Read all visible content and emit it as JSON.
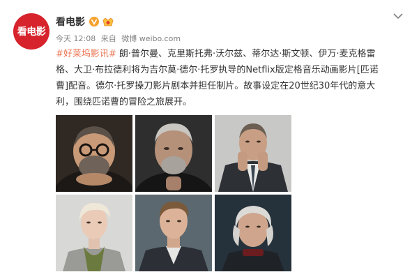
{
  "post": {
    "author": "看电影",
    "avatar_text": "看电影",
    "time": "今天 12:08",
    "source_prefix": "来自",
    "source": "微博 weibo.com",
    "hashtag": "#好莱坞影讯#",
    "body_lines": [
      " 朗·普尔曼、克里斯托弗·沃尔兹、蒂尔达·斯文顿、伊万·麦克格雷",
      "格、大卫·布拉德利将为吉尔莫·德尔·托罗执导的Netflix版定格音乐动画影片[匹诺",
      "曹]配音。德尔·托罗操刀影片剧本并担任制片。故事设定在20世纪30年代的意大",
      "利，围绕匹诺曹的冒险之旅展开。"
    ]
  },
  "icons": {
    "verified": "verified-v-icon",
    "badge": "vip-badge-icon",
    "menu": "chevron-down-icon"
  },
  "colors": {
    "avatar_bg": "#d6232c",
    "hashtag": "#eb7350",
    "verified": "#f7a12c",
    "meta_text": "#808080"
  },
  "photos": [
    {
      "name": "guillermo-del-toro"
    },
    {
      "name": "ron-perlman"
    },
    {
      "name": "christoph-waltz"
    },
    {
      "name": "tilda-swinton"
    },
    {
      "name": "ewan-mcgregor"
    },
    {
      "name": "david-bradley"
    }
  ]
}
